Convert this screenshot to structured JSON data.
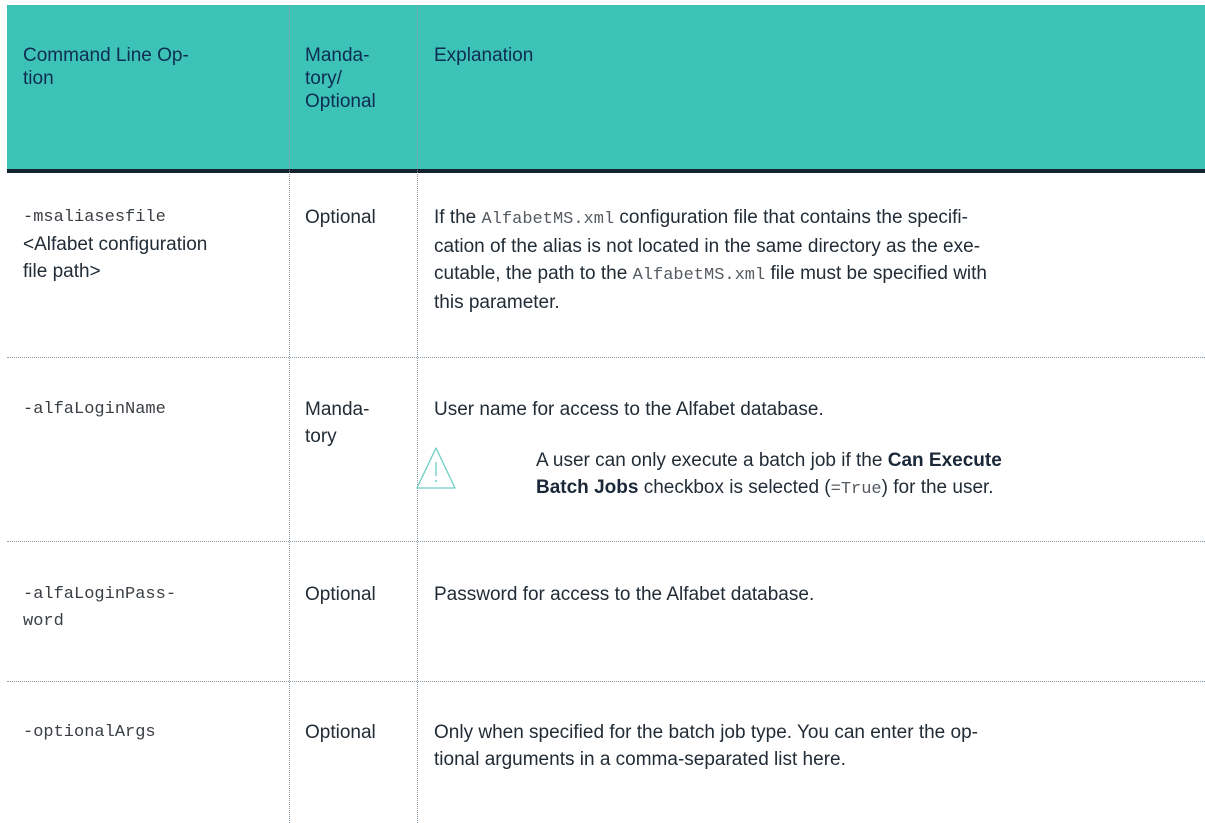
{
  "header": {
    "col1": "Command Line Op-\ntion",
    "col2": "Manda-\ntory/\nOptional",
    "col3": "Explanation"
  },
  "rows": [
    {
      "option": "-msaliasesfile",
      "option_arg": "<Alfabet configuration\nfile path>",
      "status": "Optional",
      "explanation": {
        "p1": "If the ",
        "code1": "AlfabetMS.xml",
        "p2": " configuration file that contains the specifi-\ncation of the alias is not located in the same directory as the exe-\ncutable, the path to the ",
        "code2": "AlfabetMS.xml",
        "p3": " file must be specified with\nthis parameter."
      }
    },
    {
      "option": "-alfaLoginName",
      "status": "Manda-\ntory",
      "explanation": "User name for access to the Alfabet database.",
      "note": {
        "icon": "warning-triangle-icon",
        "p1": "A user can only execute a batch job if the ",
        "bold1": "Can Execute",
        "bold2": "Batch Jobs",
        "p2": " checkbox is selected (",
        "code": "=True",
        "p3": ") for the user."
      }
    },
    {
      "option": "-alfaLoginPass-\nword",
      "status": "Optional",
      "explanation": "Password for access to the Alfabet database."
    },
    {
      "option": "-optionalArgs",
      "status": "Optional",
      "explanation": "Only when specified for the batch job type. You can enter the op-\ntional arguments in a comma-separated list here."
    }
  ]
}
